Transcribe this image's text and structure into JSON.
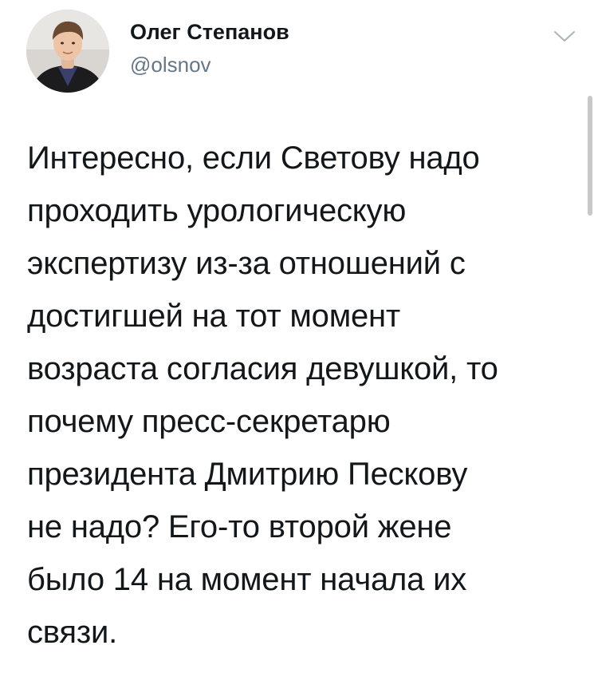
{
  "author": {
    "name": "Олег Степанов",
    "handle": "@olsnov",
    "avatar_icon": "user-avatar-photo"
  },
  "menu_icon": "chevron-down-icon",
  "tweet": {
    "lines": [
      "Интересно, если Светову надо",
      "проходить урологическую",
      "экспертизу из-за отношений с",
      "достигшей на тот момент",
      "возраста согласия девушкой, то",
      "почему пресс-секретарю",
      "президента Дмитрию Пескову",
      "не надо? Его-то второй жене",
      "было 14 на момент начала их",
      "связи."
    ]
  },
  "colors": {
    "text": "#14171a",
    "secondary": "#657786",
    "background": "#ffffff"
  }
}
